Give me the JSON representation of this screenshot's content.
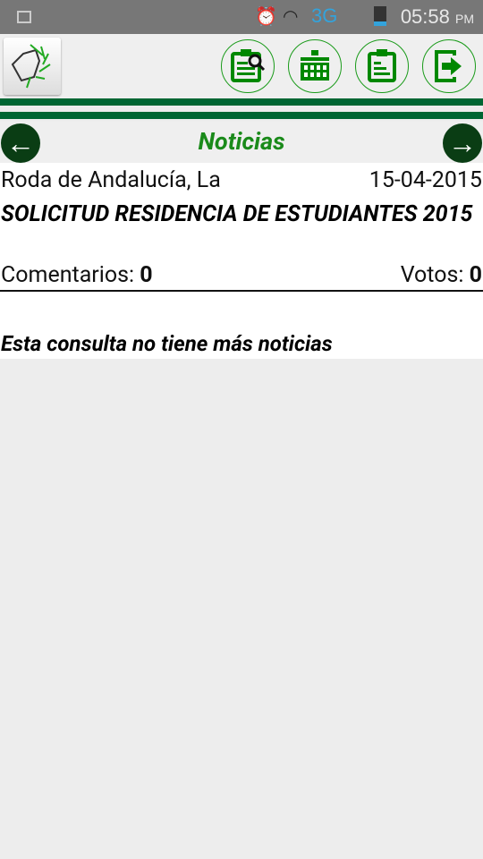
{
  "status_bar": {
    "network": "3G",
    "time": "05:58",
    "ampm": "PM"
  },
  "header": {
    "buttons": [
      {
        "icon": "clipboard-search-icon"
      },
      {
        "icon": "calendar-grid-icon"
      },
      {
        "icon": "clipboard-icon"
      },
      {
        "icon": "logout-icon"
      }
    ],
    "accent": "#006633"
  },
  "nav": {
    "title": "Noticias",
    "prev": "←",
    "next": "→"
  },
  "news": {
    "location": "Roda de Andalucía, La",
    "date": "15-04-2015",
    "headline": "SOLICITUD RESIDENCIA DE ESTUDIANTES 2015",
    "comments_label": "Comentarios:",
    "comments": "0",
    "votes_label": "Votos:",
    "votes": "0"
  },
  "footer_message": "Esta consulta no tiene más noticias"
}
